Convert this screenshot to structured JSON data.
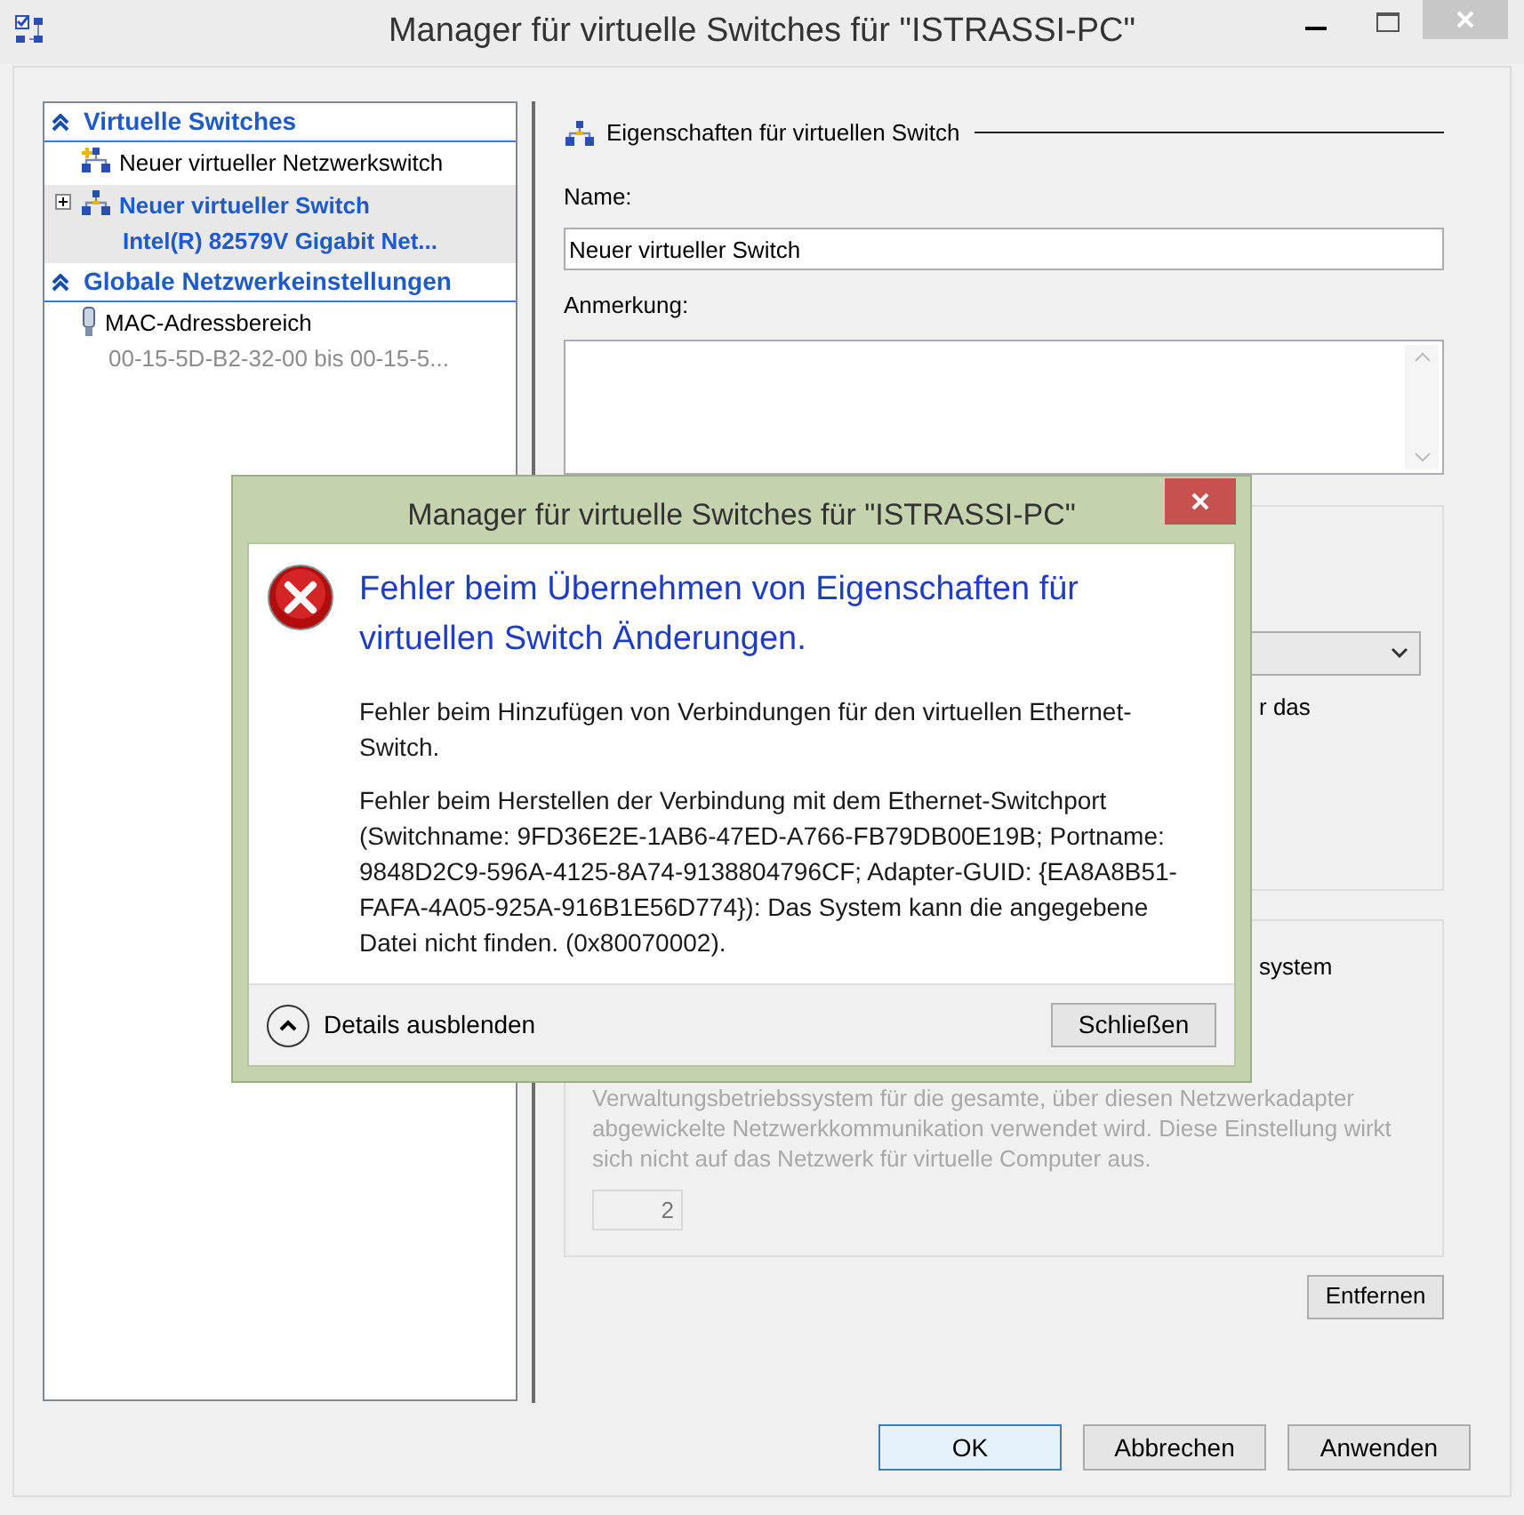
{
  "window": {
    "title": "Manager für virtuelle Switches für \"ISTRASSI-PC\""
  },
  "sidebar": {
    "sections": [
      {
        "title": "Virtuelle Switches",
        "expanded": true,
        "items": [
          {
            "kind": "new",
            "label": "Neuer virtueller Netzwerkswitch",
            "selected": false
          },
          {
            "kind": "switch",
            "label": "Neuer virtueller Switch",
            "sublabel": "Intel(R) 82579V Gigabit Net...",
            "selected": true,
            "expanded": false
          }
        ]
      },
      {
        "title": "Globale Netzwerkeinstellungen",
        "expanded": true,
        "items": [
          {
            "kind": "mac",
            "label": "MAC-Adressbereich",
            "sublabel": "00-15-5D-B2-32-00 bis 00-15-5...",
            "selected": false
          }
        ]
      }
    ]
  },
  "properties": {
    "heading": "Eigenschaften für virtuellen Switch",
    "name_label": "Name:",
    "name_value": "Neuer virtueller Switch",
    "note_label": "Anmerkung:",
    "group_1_fragment": "r das",
    "group_2_fragment": "system",
    "group_2_text": "Verwaltungsbetriebssystem für die gesamte, über diesen Netzwerkadapter abgewickelte Netzwerkkommunikation verwendet wird. Diese Einstellung wirkt sich nicht auf das Netzwerk für virtuelle Computer aus.",
    "group_2_disabled": true,
    "vlan_value": "2",
    "remove_button": "Entfernen"
  },
  "buttons": [
    {
      "label": "OK",
      "default": true
    },
    {
      "label": "Abbrechen",
      "default": false
    },
    {
      "label": "Anwenden",
      "default": false
    }
  ],
  "dialog": {
    "title": "Manager für virtuelle Switches für \"ISTRASSI-PC\"",
    "heading": "Fehler beim Übernehmen von Eigenschaften für virtuellen Switch Änderungen.",
    "paragraphs": [
      "Fehler beim Hinzufügen von Verbindungen für den virtuellen Ethernet-Switch.",
      "Fehler beim Herstellen der Verbindung mit dem Ethernet-Switchport (Switchname: 9FD36E2E-1AB6-47ED-A766-FB79DB00E19B; Portname: 9848D2C9-596A-4125-8A74-9138804796CF; Adapter-GUID: {EA8A8B51-FAFA-4A05-925A-916B1E56D774}): Das System kann die angegebene Datei nicht finden. (0x80070002)."
    ],
    "details_expanded": true,
    "details_label": "Details ausblenden",
    "close_button": "Schließen"
  }
}
